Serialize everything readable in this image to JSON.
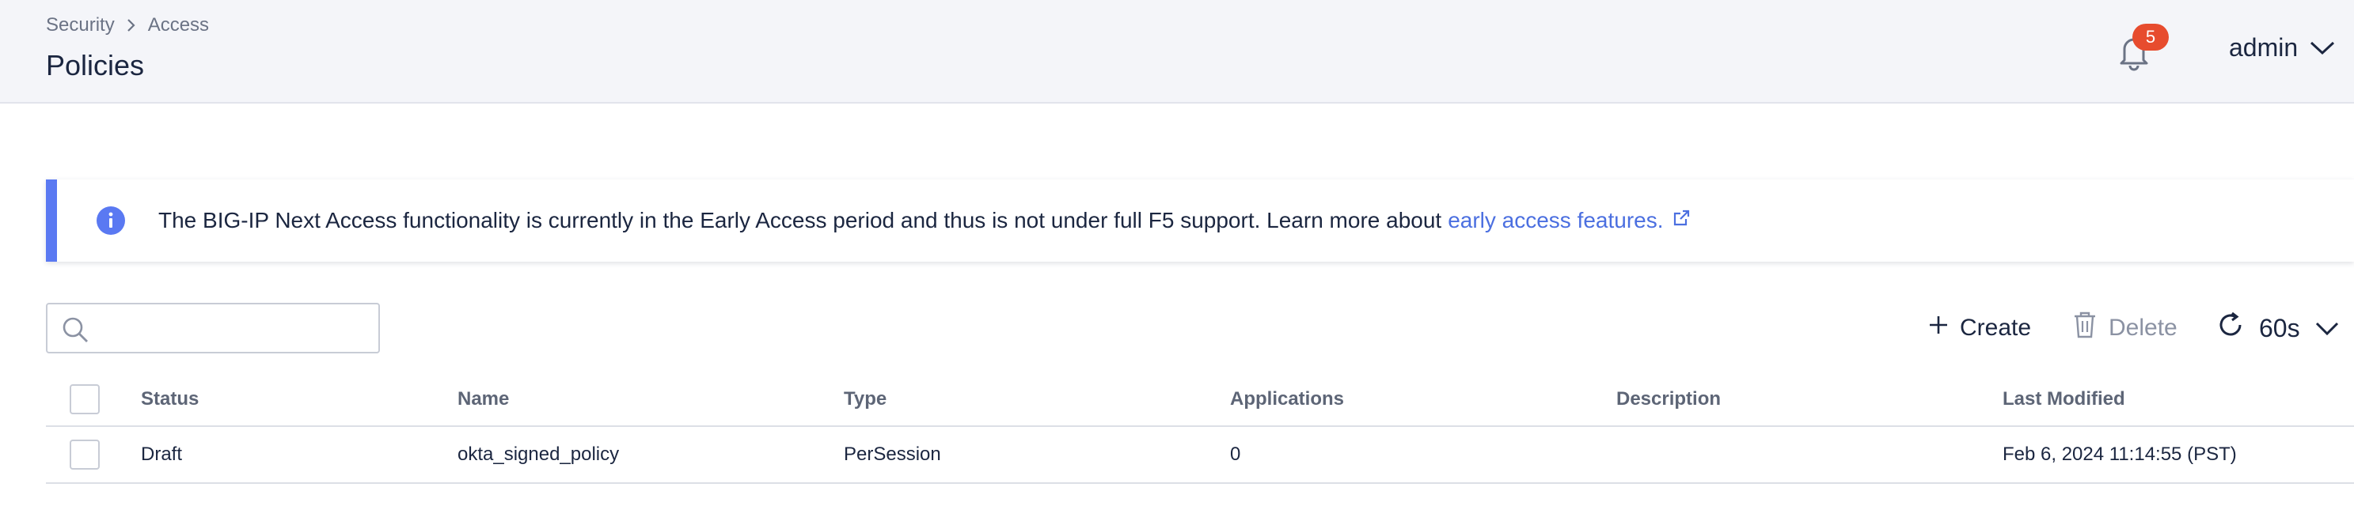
{
  "header": {
    "breadcrumb": [
      "Security",
      "Access"
    ],
    "title": "Policies",
    "notifications_count": "5",
    "user": "admin"
  },
  "banner": {
    "text": "The BIG-IP Next Access functionality is currently in the Early Access period and thus is not under full F5 support. Learn more about",
    "link_text": "early access features."
  },
  "toolbar": {
    "search_placeholder": "",
    "create_label": "Create",
    "delete_label": "Delete",
    "refresh_interval": "60s"
  },
  "table": {
    "columns": [
      "Status",
      "Name",
      "Type",
      "Applications",
      "Description",
      "Last Modified"
    ],
    "rows": [
      {
        "status": "Draft",
        "name": "okta_signed_policy",
        "type": "PerSession",
        "applications": "0",
        "description": "",
        "last_modified": "Feb 6, 2024 11:14:55 (PST)"
      }
    ]
  },
  "colors": {
    "accent": "#5a79f2",
    "link": "#4b6fe0",
    "badge": "#e74c2e",
    "header_bg": "#f4f5f9"
  },
  "icons": [
    "chevron-right-icon",
    "bell-icon",
    "chevron-down-icon",
    "info-icon",
    "external-link-icon",
    "search-icon",
    "plus-icon",
    "trash-icon",
    "refresh-icon"
  ]
}
